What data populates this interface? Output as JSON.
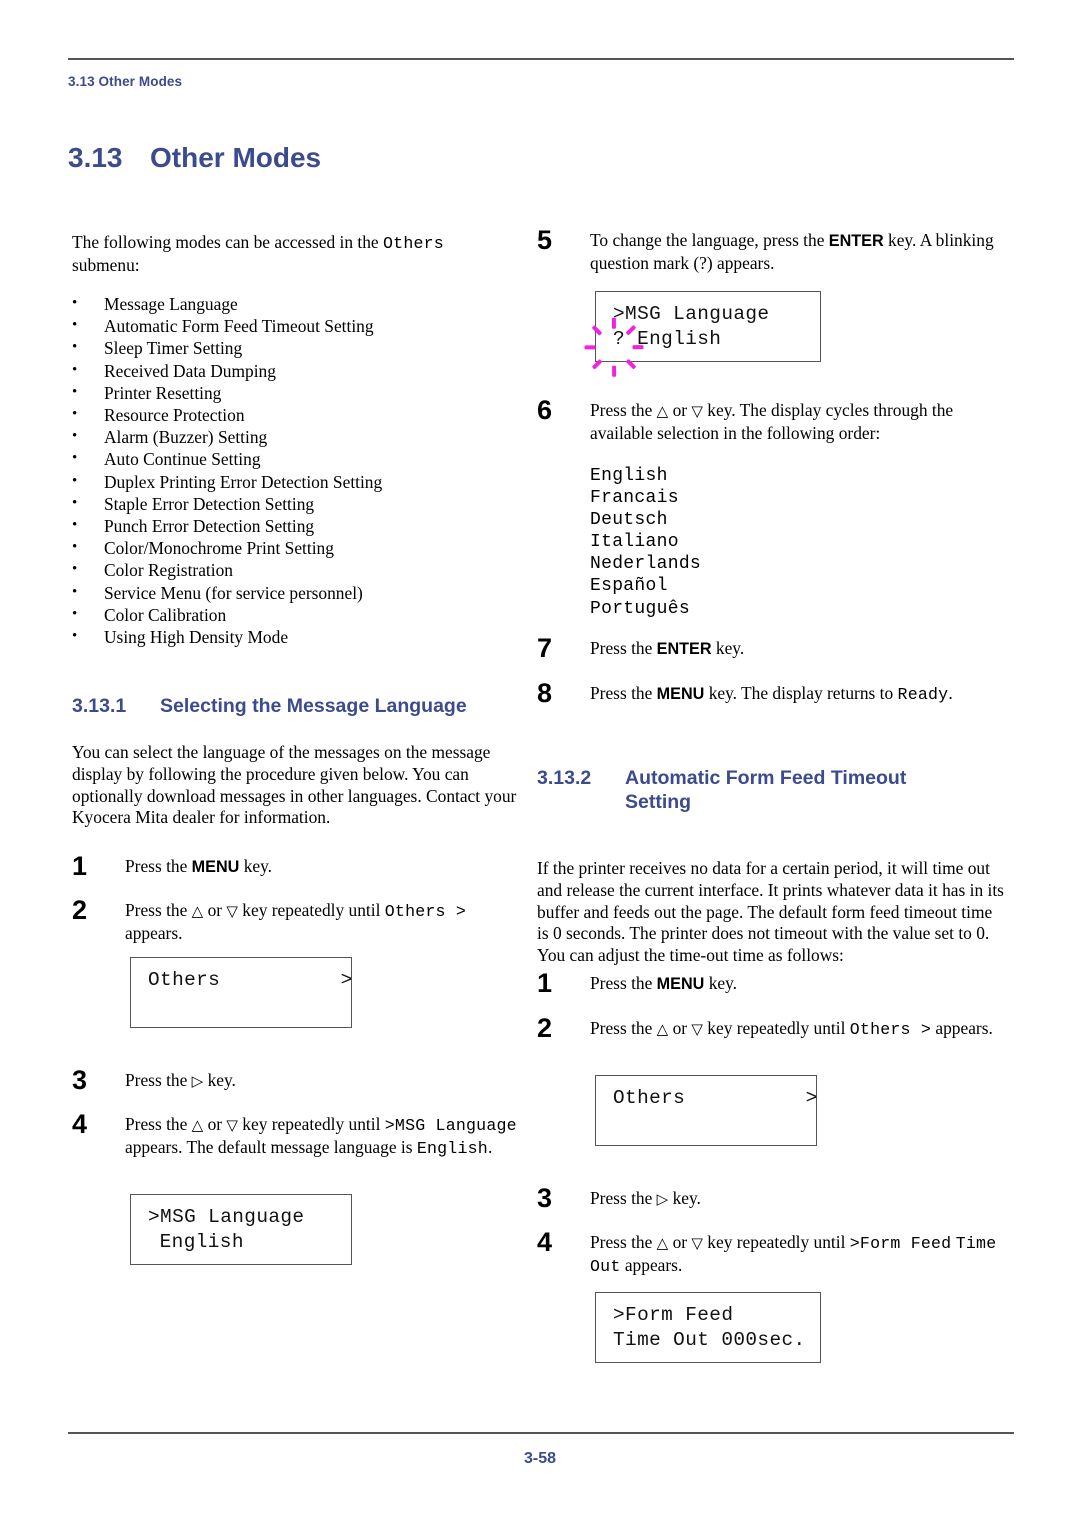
{
  "header": {
    "running_head": "3.13 Other Modes"
  },
  "section": {
    "number": "3.13",
    "title": "Other Modes"
  },
  "intro": {
    "paragraph_before": "The following modes can be accessed in the ",
    "mono_term": "Others",
    "paragraph_after": " submenu:"
  },
  "modes_list": [
    "Message Language",
    "Automatic Form Feed Timeout Setting",
    "Sleep Timer Setting",
    "Received Data Dumping",
    "Printer Resetting",
    "Resource Protection",
    "Alarm (Buzzer) Setting",
    "Auto Continue Setting",
    "Duplex Printing Error Detection Setting",
    "Staple Error Detection Setting",
    "Punch Error Detection Setting",
    "Color/Monochrome Print Setting",
    "Color Registration",
    "Service Menu (for service personnel)",
    "Color Calibration",
    "Using High Density Mode"
  ],
  "subsection_1": {
    "number": "3.13.1",
    "title": "Selecting the Message Language",
    "intro": "You can select the language of the messages on the message display by following the procedure given below. You can optionally download messages in other languages. Contact your Kyocera Mita dealer for information.",
    "steps": {
      "s1_num": "1",
      "s1_pre": "Press the ",
      "s1_key": "MENU",
      "s1_post": " key.",
      "s2_num": "2",
      "s2_pre": "Press the ",
      "s2_up": "△",
      "s2_mid": " or ",
      "s2_down": "▽",
      "s2_post": " key repeatedly until ",
      "s2_mono": "Others  >",
      "s2_tail": " appears.",
      "s3_num": "3",
      "s3_pre": "Press the ",
      "s3_right": "▷",
      "s3_post": " key.",
      "s4_num": "4",
      "s4_pre": "Press the ",
      "s4_up": "△",
      "s4_mid": " or ",
      "s4_down": "▽",
      "s4_post": " key repeatedly until ",
      "s4_mono1": ">MSG Language",
      "s4_tail1": " appears. The default message language is ",
      "s4_mono2": "English",
      "s4_tail2": "."
    },
    "lcd_others": {
      "line1": "Others          >",
      "line2": ""
    },
    "lcd_msg": {
      "line1": ">MSG Language",
      "line2": "English"
    }
  },
  "subsection_1_right": {
    "steps": {
      "s5_num": "5",
      "s5_pre": "To change the language, press the ",
      "s5_key": "ENTER",
      "s5_post": " key. A blinking question mark (?) appears.",
      "s6_num": "6",
      "s6_pre": "Press the ",
      "s6_up": "△",
      "s6_mid": " or ",
      "s6_down": "▽",
      "s6_post": " key. The display cycles through the available selection in the following order:",
      "s7_num": "7",
      "s7_pre": "Press the ",
      "s7_key": "ENTER",
      "s7_post": " key.",
      "s8_num": "8",
      "s8_pre": "Press the ",
      "s8_key": "MENU",
      "s8_post": " key. The display returns to ",
      "s8_mono": "Ready",
      "s8_tail": "."
    },
    "lcd_msg_blink": {
      "line1": ">MSG Language",
      "line2_marker": "?",
      "line2_value": "English",
      "blink_color": "#f321dd"
    },
    "languages": [
      "English",
      "Francais",
      "Deutsch",
      "Italiano",
      "Nederlands",
      "Español",
      "Português"
    ]
  },
  "subsection_2": {
    "number": "3.13.2",
    "title_line1": "Automatic Form Feed Timeout",
    "title_line2": "Setting",
    "intro": "If the printer receives no data for a certain period, it will time out and release the current interface. It prints whatever data it has in its buffer and feeds out the page. The default form feed timeout time is 0 seconds. The printer does not timeout with the value set to 0. You can adjust the time-out time as follows:",
    "steps": {
      "s1_num": "1",
      "s1_pre": "Press the ",
      "s1_key": "MENU",
      "s1_post": " key.",
      "s2_num": "2",
      "s2_pre": "Press the ",
      "s2_up": "△",
      "s2_mid": " or ",
      "s2_down": "▽",
      "s2_post": " key repeatedly until ",
      "s2_mono": "Others  >",
      "s2_tail": " appears.",
      "s3_num": "3",
      "s3_pre": "Press the ",
      "s3_right": "▷",
      "s3_post": " key.",
      "s4_num": "4",
      "s4_pre": "Press the ",
      "s4_up": "△",
      "s4_mid": " or ",
      "s4_down": "▽",
      "s4_post": " key repeatedly until ",
      "s4_mono1": ">Form Feed",
      "s4_mid2": " ",
      "s4_mono2": "Time Out",
      "s4_tail": " appears."
    },
    "lcd_others": {
      "line1": "Others          >",
      "line2": ""
    },
    "lcd_formfeed": {
      "line1": ">Form Feed",
      "line2": "Time Out 000sec."
    }
  },
  "footer": {
    "page_number": "3-58"
  },
  "colors": {
    "heading_blue": "#3c4a8e",
    "rule_gray": "#555555",
    "blink_magenta": "#f321dd"
  }
}
